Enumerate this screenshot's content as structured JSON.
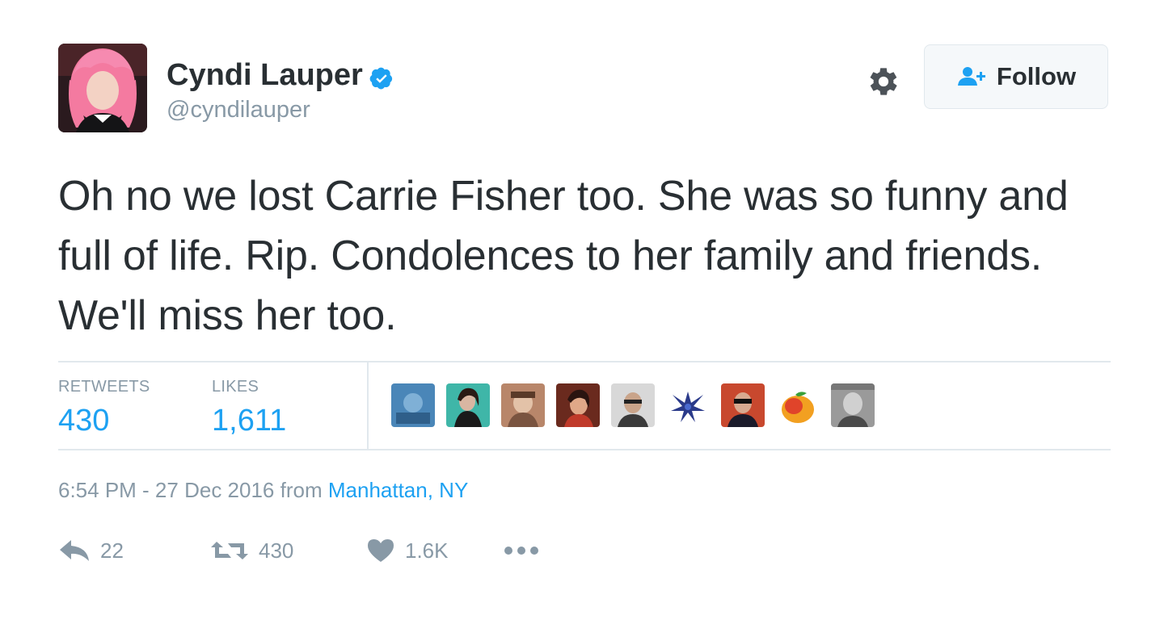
{
  "tweet": {
    "author": {
      "name": "Cyndi Lauper",
      "handle": "@cyndilauper",
      "verified": true
    },
    "follow_label": "Follow",
    "text": "Oh no we lost Carrie Fisher too. She was so funny and full of life. Rip. Condolences to her family and friends. We'll miss her too.",
    "stats": {
      "retweets_label": "RETWEETS",
      "retweets_value": "430",
      "likes_label": "LIKES",
      "likes_value": "1,611"
    },
    "likers": [
      "liker-1",
      "liker-2",
      "liker-3",
      "liker-4",
      "liker-5",
      "liker-6",
      "liker-7",
      "liker-8",
      "liker-9"
    ],
    "meta": {
      "time_date": "6:54 PM - 27 Dec 2016",
      "from_label": "from",
      "location": "Manhattan, NY"
    },
    "actions": {
      "reply_count": "22",
      "retweet_count": "430",
      "like_count": "1.6K"
    }
  },
  "icons": [
    "verified-badge-icon",
    "gear-icon",
    "follow-person-icon",
    "reply-icon",
    "retweet-icon",
    "heart-icon",
    "more-icon"
  ],
  "colors": {
    "accent": "#1da1f2",
    "text": "#292f33",
    "muted": "#8899a6",
    "border": "#e1e8ed"
  }
}
